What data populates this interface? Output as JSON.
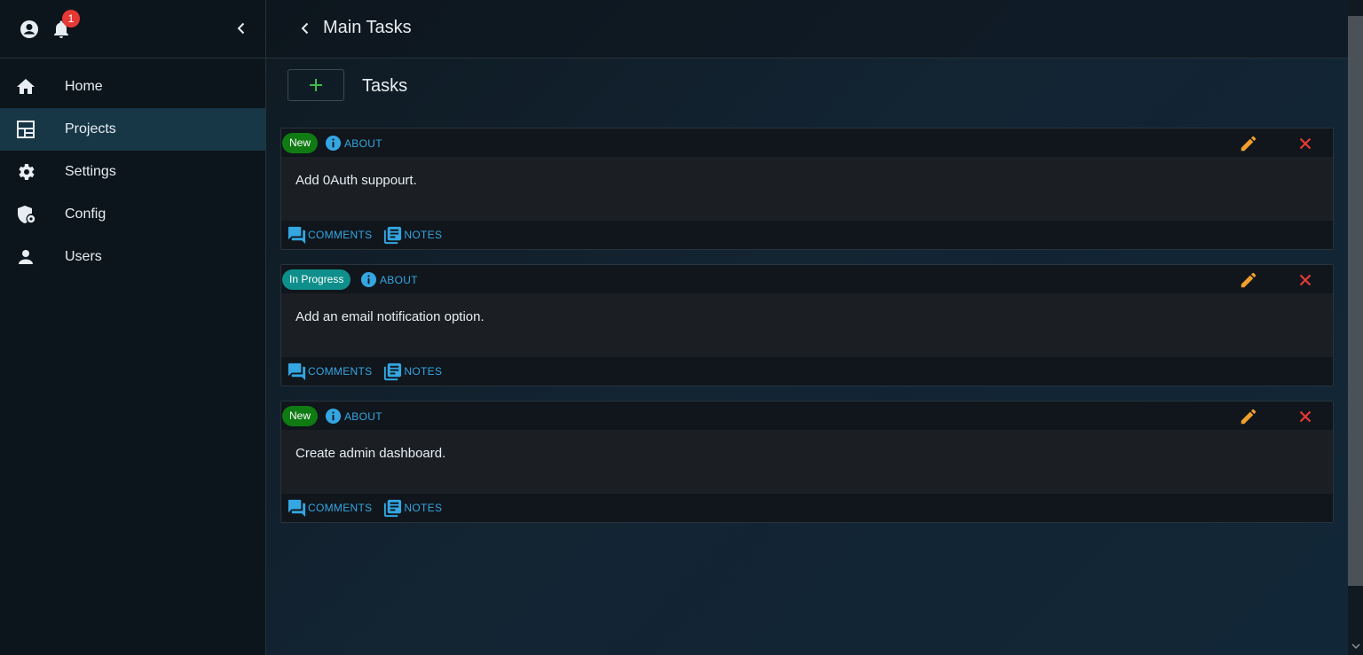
{
  "sidebar": {
    "notification_count": "1",
    "items": [
      {
        "label": "Home",
        "icon": "home-icon"
      },
      {
        "label": "Projects",
        "icon": "projects-icon",
        "active": true
      },
      {
        "label": "Settings",
        "icon": "gear-icon"
      },
      {
        "label": "Config",
        "icon": "shield-config-icon"
      },
      {
        "label": "Users",
        "icon": "person-icon"
      }
    ]
  },
  "header": {
    "title": "Main Tasks"
  },
  "toolbar": {
    "section_title": "Tasks",
    "add_symbol": "+"
  },
  "tasks": [
    {
      "status": "New",
      "status_color": "#0f7b12",
      "about": "ABOUT",
      "text": "Add 0Auth suppourt.",
      "comments": "COMMENTS",
      "notes": "NOTES"
    },
    {
      "status": "In Progress",
      "status_color": "#0f8f8b",
      "about": "ABOUT",
      "text": "Add an email notification option.",
      "comments": "COMMENTS",
      "notes": "NOTES"
    },
    {
      "status": "New",
      "status_color": "#0f7b12",
      "about": "ABOUT",
      "text": "Create admin dashboard.",
      "comments": "COMMENTS",
      "notes": "NOTES"
    }
  ],
  "colors": {
    "accent_link": "#34a6e2",
    "edit": "#f0a02a",
    "delete": "#e53935",
    "sidebar_active": "#173746"
  }
}
